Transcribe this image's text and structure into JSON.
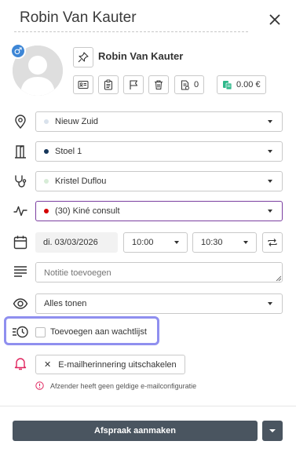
{
  "header": {
    "title": "Robin Van Kauter"
  },
  "patient": {
    "name": "Robin Van Kauter",
    "gender_symbol": "♂",
    "actions": [
      "id-card",
      "clipboard",
      "flag",
      "trash"
    ],
    "documents_count": "0",
    "balance": "0.00 €"
  },
  "fields": {
    "location": {
      "value": "Nieuw Zuid",
      "dot_color": "#d9e2ec"
    },
    "room": {
      "value": "Stoel 1",
      "dot_color": "#16365a"
    },
    "therapist": {
      "value": "Kristel Duflou",
      "dot_color": "#d7ecd7"
    },
    "service": {
      "value": "(30) Kiné consult",
      "dot_color": "#d40000"
    },
    "date": "di. 03/03/2026",
    "start_time": "10:00",
    "end_time": "10:30",
    "notes_placeholder": "Notitie toevoegen",
    "visibility": "Alles tonen"
  },
  "waitlist": {
    "label": "Toevoegen aan wachtlijst",
    "checked": false
  },
  "email": {
    "button_label": "E-mailherinnering uitschakelen",
    "warning": "Afzender heeft geen geldige e-mailconfiguratie"
  },
  "footer": {
    "submit_label": "Afspraak aanmaken"
  },
  "colors": {
    "accent": "#7b3fa0",
    "highlight": "#8f8fef",
    "bell": "#e0245e",
    "money": "#2eb88a",
    "primary_button": "#4a5560"
  }
}
